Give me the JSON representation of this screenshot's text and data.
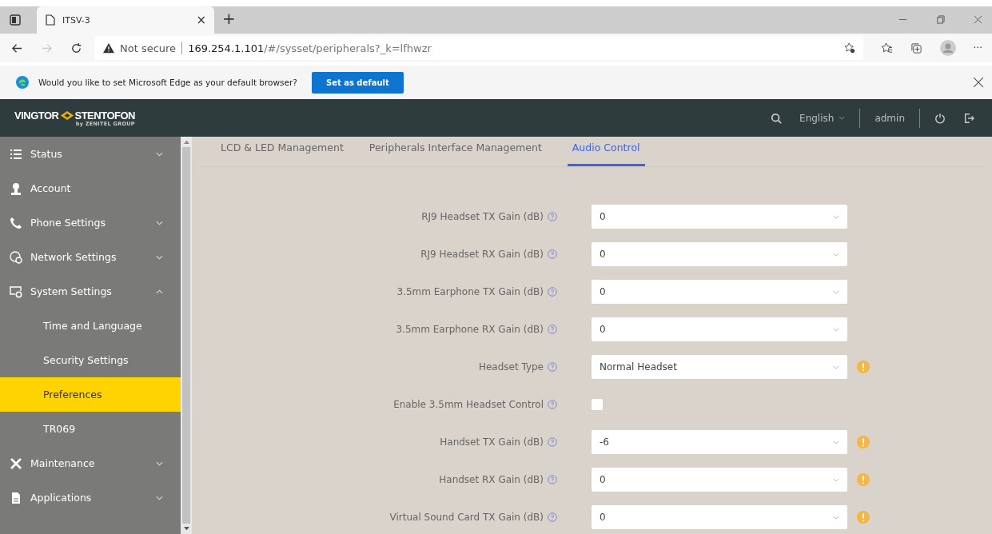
{
  "browser": {
    "tab_title": "ITSV-3",
    "tab_close": "×",
    "new_tab": "+",
    "security": "Not secure",
    "url_host": "169.254.1.101",
    "url_path": "/#/sysset/peripherals?_k=lfhwzr",
    "more": "···"
  },
  "infobar": {
    "message": "Would you like to set Microsoft Edge as your default browser?",
    "button": "Set as default"
  },
  "header": {
    "brand_left": "VINGTOR",
    "brand_right": "STENTOFON",
    "brand_sub": "by ZENITEL GROUP",
    "language": "English",
    "user": "admin"
  },
  "sidebar": {
    "items": [
      {
        "label": "Status",
        "expanded": false,
        "selected": false
      },
      {
        "label": "Account",
        "selected": false
      },
      {
        "label": "Phone Settings",
        "expanded": false,
        "selected": false
      },
      {
        "label": "Network Settings",
        "expanded": false,
        "selected": false
      },
      {
        "label": "System Settings",
        "expanded": true,
        "selected": false,
        "children": [
          {
            "label": "Time and Language",
            "selected": false
          },
          {
            "label": "Security Settings",
            "selected": false
          },
          {
            "label": "Preferences",
            "selected": true
          },
          {
            "label": "TR069",
            "selected": false
          }
        ]
      },
      {
        "label": "Maintenance",
        "expanded": false,
        "selected": false
      },
      {
        "label": "Applications",
        "expanded": false,
        "selected": false
      }
    ]
  },
  "tabs": [
    {
      "label": "LCD & LED Management",
      "selected": false
    },
    {
      "label": "Peripherals Interface Management",
      "selected": false
    },
    {
      "label": "Audio Control",
      "selected": true
    }
  ],
  "form": [
    {
      "kind": "select",
      "label": "RJ9 Headset TX Gain (dB)",
      "value": "0",
      "warning": false
    },
    {
      "kind": "select",
      "label": "RJ9 Headset RX Gain (dB)",
      "value": "0",
      "warning": false
    },
    {
      "kind": "select",
      "label": "3.5mm Earphone TX Gain (dB)",
      "value": "0",
      "warning": false
    },
    {
      "kind": "select",
      "label": "3.5mm Earphone RX Gain (dB)",
      "value": "0",
      "warning": false
    },
    {
      "kind": "select",
      "label": "Headset Type",
      "value": "Normal Headset",
      "warning": true
    },
    {
      "kind": "checkbox",
      "label": "Enable 3.5mm Headset Control",
      "checked": false,
      "warning": false
    },
    {
      "kind": "select",
      "label": "Handset TX Gain (dB)",
      "value": "-6",
      "warning": true
    },
    {
      "kind": "select",
      "label": "Handset RX Gain (dB)",
      "value": "0",
      "warning": true
    },
    {
      "kind": "select",
      "label": "Virtual Sound Card TX Gain (dB)",
      "value": "0",
      "warning": true
    }
  ]
}
